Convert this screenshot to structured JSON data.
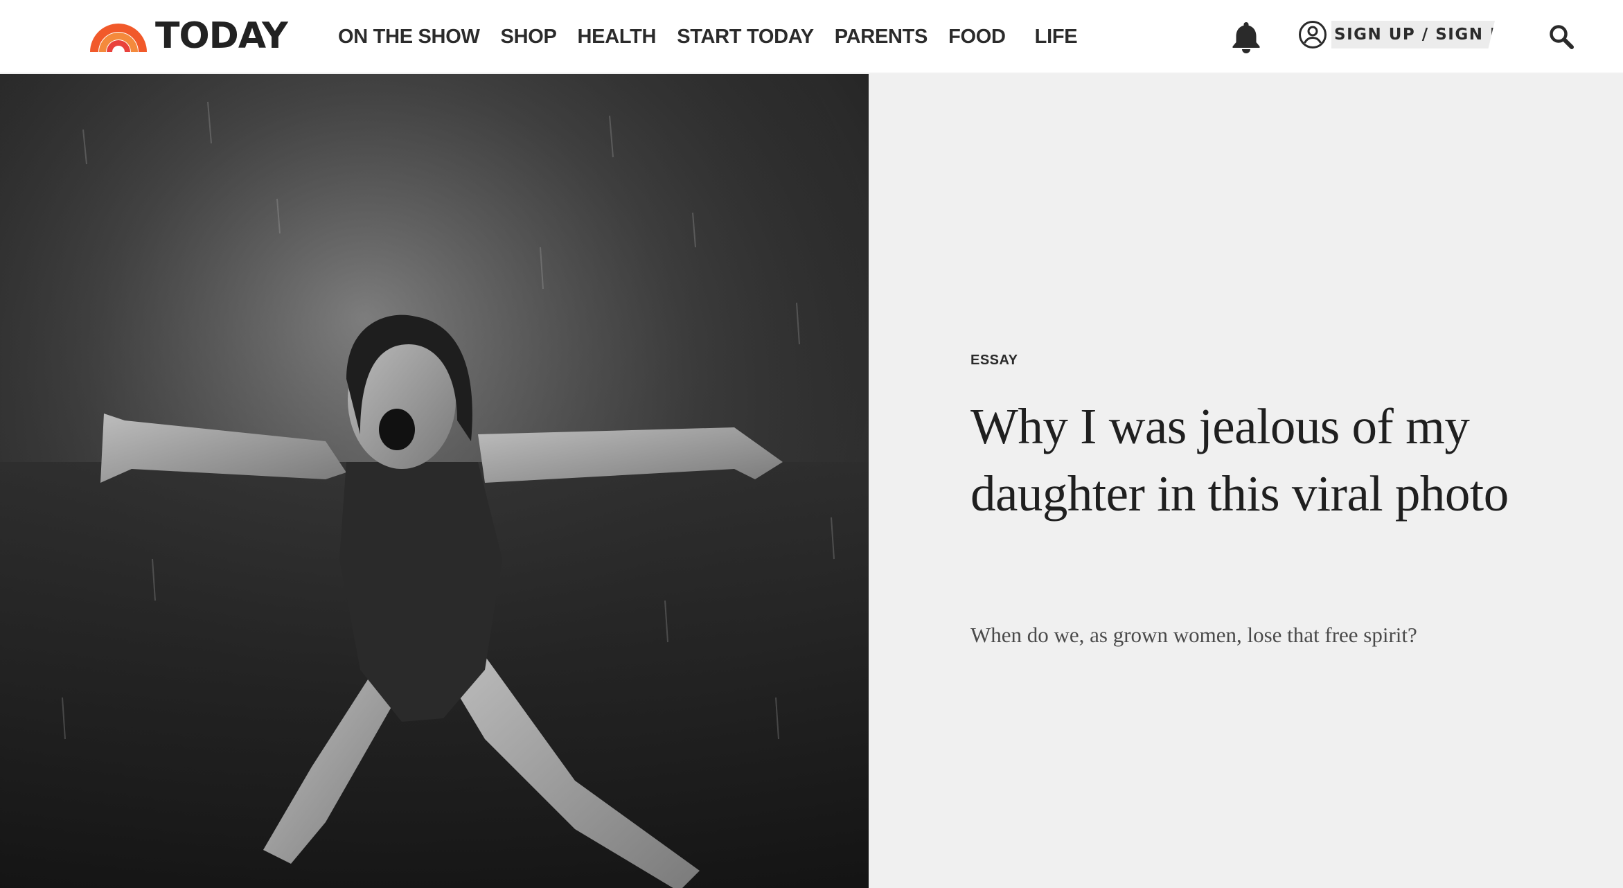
{
  "brand": {
    "name": "TODAY",
    "logo_colors": [
      "#f1592a",
      "#f48a3c",
      "#e9423c"
    ]
  },
  "nav": {
    "items": [
      {
        "label": "ON THE SHOW"
      },
      {
        "label": "SHOP"
      },
      {
        "label": "HEALTH"
      },
      {
        "label": "START TODAY"
      },
      {
        "label": "PARENTS"
      },
      {
        "label": "FOOD"
      },
      {
        "label": "LIFE"
      }
    ]
  },
  "header": {
    "notifications_icon": "bell-icon",
    "account_icon": "user-circle-icon",
    "signin_label": "SIGN UP / SIGN IN",
    "search_icon": "search-icon"
  },
  "article": {
    "eyebrow": "ESSAY",
    "headline": "Why I was jealous of my daughter in this viral photo",
    "dek": "When do we, as grown women, lose that free spirit?",
    "image": "black-and-white photo of a girl with arms outstretched in the rain",
    "panel_color": "#f0f0f0"
  }
}
